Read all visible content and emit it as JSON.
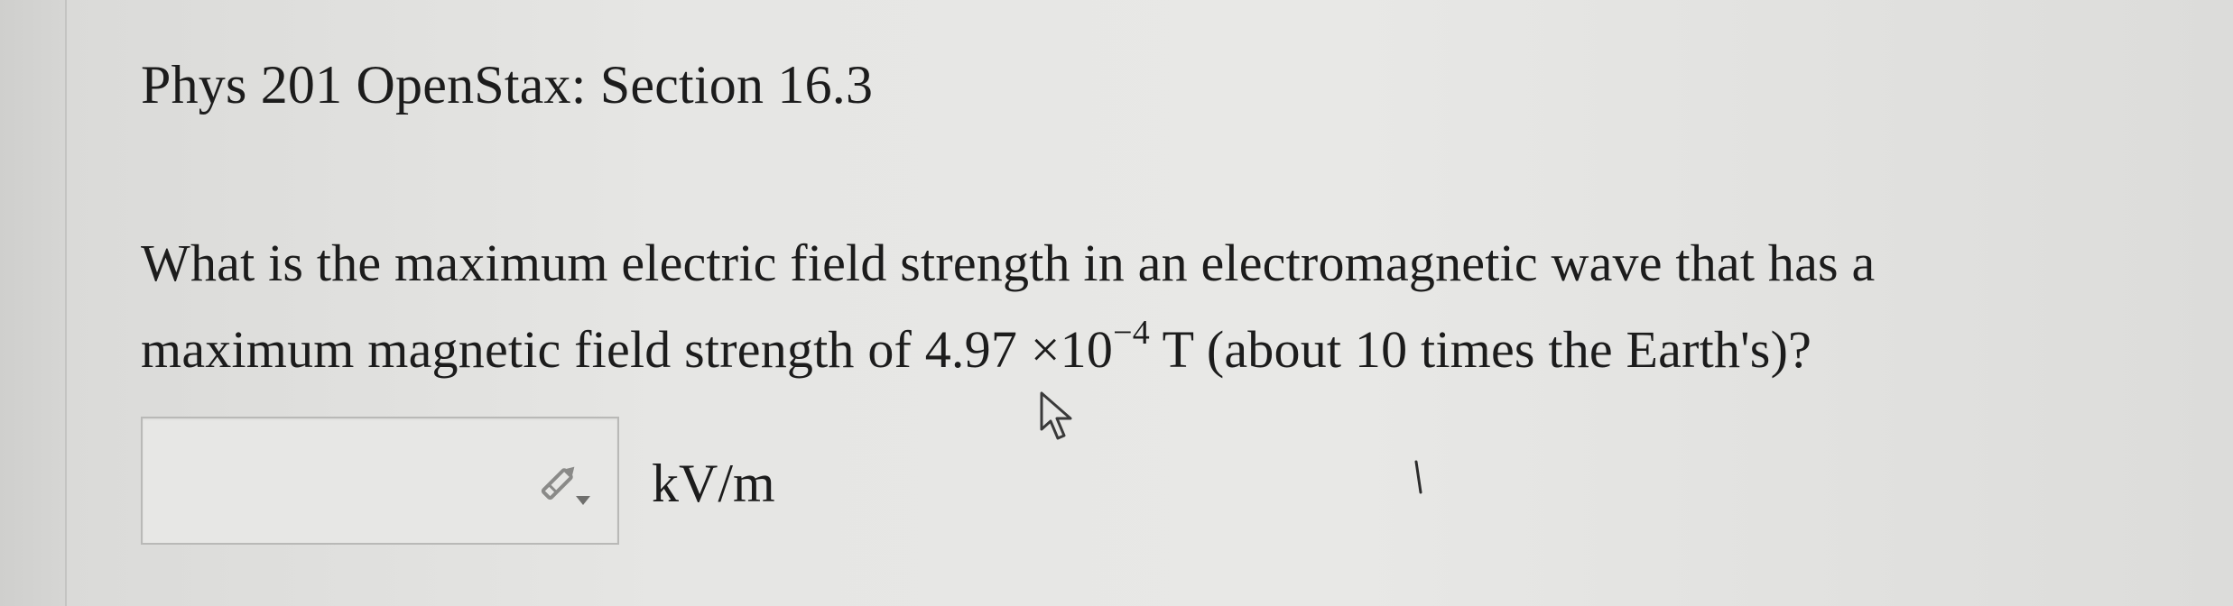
{
  "header": {
    "title": "Phys 201 OpenStax: Section 16.3"
  },
  "question": {
    "line1": "What is the maximum electric field strength in an electromagnetic wave that has a",
    "line2_before": "maximum magnetic field strength of ",
    "mantissa": "4.97",
    "times": "×",
    "base": "10",
    "exponent": "−4",
    "line2_after": " T (about 10 times the Earth's)?"
  },
  "answer": {
    "value": "",
    "placeholder": "",
    "unit": "kV/m",
    "tool_icon": "pencil-dropdown-icon"
  },
  "pointer": {
    "icon": "mouse-cursor-icon"
  },
  "colors": {
    "background": "#e6e6e4",
    "text": "#1c1c1c",
    "box_border": "#b9b9b7"
  }
}
